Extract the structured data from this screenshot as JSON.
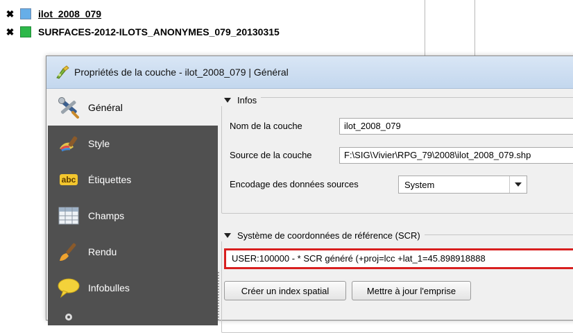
{
  "layers": [
    {
      "name": "ilot_2008_079",
      "color": "#66aee8",
      "checked_symbol": "✖"
    },
    {
      "name": "SURFACES-2012-ILOTS_ANONYMES_079_20130315",
      "color": "#2db84a",
      "checked_symbol": "✖"
    }
  ],
  "dialog": {
    "title": "Propriétés de la couche - ilot_2008_079 | Général",
    "title_icon": "qgis-layer-properties-icon"
  },
  "sidebar": {
    "items": [
      {
        "label": "Général",
        "icon": "tools-icon"
      },
      {
        "label": "Style",
        "icon": "paint-brush-icon"
      },
      {
        "label": "Étiquettes",
        "icon": "abc-label-icon",
        "icon_text": "abc"
      },
      {
        "label": "Champs",
        "icon": "table-icon"
      },
      {
        "label": "Rendu",
        "icon": "brush-icon"
      },
      {
        "label": "Infobulles",
        "icon": "speech-bubble-icon"
      }
    ]
  },
  "infos": {
    "title": "Infos",
    "layer_name_label": "Nom de la couche",
    "layer_name_value": "ilot_2008_079",
    "source_label": "Source de la couche",
    "source_value": "F:\\SIG\\Vivier\\RPG_79\\2008\\ilot_2008_079.shp",
    "encoding_label": "Encodage des données sources",
    "encoding_value": "System"
  },
  "crs": {
    "title": "Système de coordonnées de référence (SCR)",
    "value": "USER:100000 -  * SCR généré (+proj=lcc +lat_1=45.898918888"
  },
  "buttons": {
    "spatial_index": "Créer un index spatial",
    "update_extent": "Mettre à jour l'emprise"
  },
  "colors": {
    "sidebar_bg": "#505050",
    "crs_highlight": "#d81f1f"
  }
}
